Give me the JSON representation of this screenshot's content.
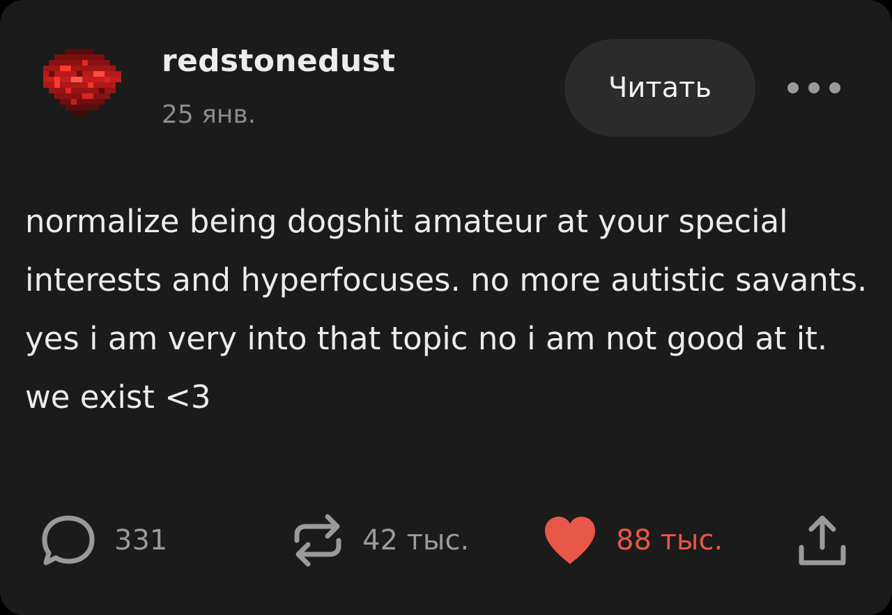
{
  "post": {
    "author": "redstonedust",
    "date": "25 янв.",
    "follow_label": "Читать",
    "body": "normalize being dogshit amateur at your special interests and hyperfocuses. no more autistic savants. yes i am very into that topic no i am not good at it. we exist <3"
  },
  "actions": {
    "comments_count": "331",
    "reblogs_count": "42 тыс.",
    "likes_count": "88 тыс."
  },
  "icons": {
    "avatar": "redstone-dust-avatar",
    "comment": "speech-bubble-icon",
    "reblog": "repeat-arrows-icon",
    "like": "heart-icon",
    "share": "share-upload-icon",
    "more": "ellipsis-icon"
  },
  "colors": {
    "background": "#1b1b1b",
    "like_active": "#e9574a",
    "button_bg": "#2b2b2b",
    "muted": "#9a9a9a"
  }
}
